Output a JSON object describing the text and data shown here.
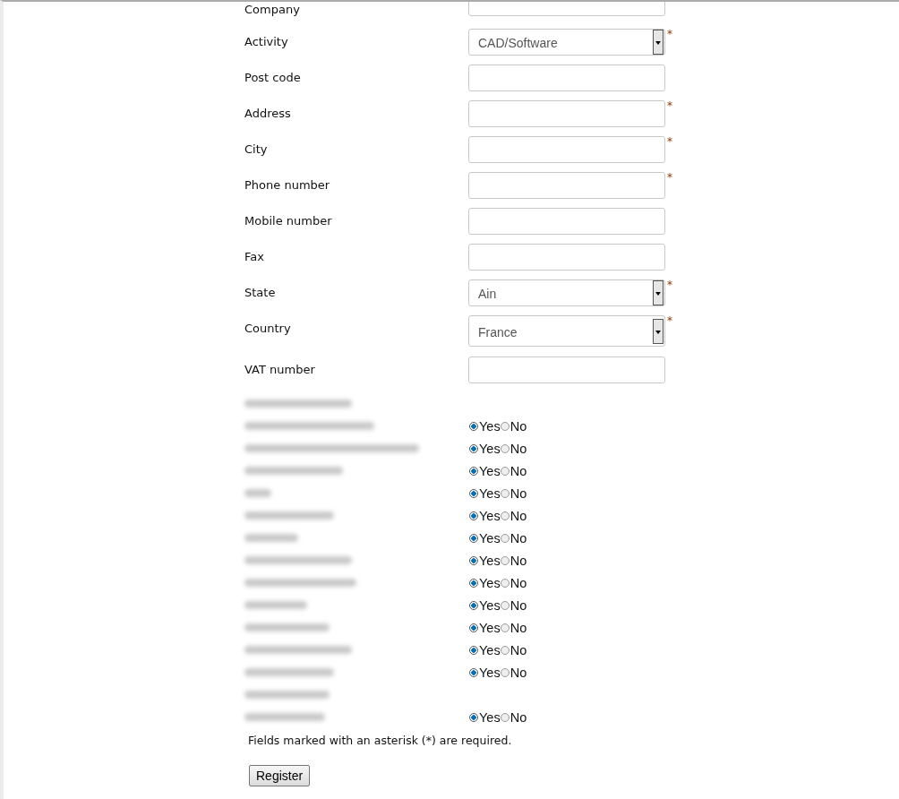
{
  "fields": [
    {
      "kind": "text",
      "label": "Company",
      "required": false
    },
    {
      "kind": "select",
      "label": "Activity",
      "value": "CAD/Software",
      "required": true
    },
    {
      "kind": "text",
      "label": "Post code",
      "required": false
    },
    {
      "kind": "text",
      "label": "Address",
      "required": true
    },
    {
      "kind": "text",
      "label": "City",
      "required": true
    },
    {
      "kind": "text",
      "label": "Phone number",
      "required": true
    },
    {
      "kind": "text",
      "label": "Mobile number",
      "required": false
    },
    {
      "kind": "text",
      "label": "Fax",
      "required": false
    },
    {
      "kind": "select",
      "label": "State",
      "value": "Ain",
      "required": true
    },
    {
      "kind": "select",
      "label": "Country",
      "value": "France",
      "required": true
    },
    {
      "kind": "text",
      "label": "VAT number",
      "required": false
    }
  ],
  "required_mark": "*",
  "interests": [
    {
      "kind": "heading"
    },
    {
      "kind": "choice",
      "options": [
        {
          "label": "Yes",
          "selected": true
        },
        {
          "label": "No",
          "selected": false
        }
      ]
    },
    {
      "kind": "choice",
      "options": [
        {
          "label": "Yes",
          "selected": true
        },
        {
          "label": "No",
          "selected": false
        }
      ]
    },
    {
      "kind": "choice",
      "options": [
        {
          "label": "Yes",
          "selected": true
        },
        {
          "label": "No",
          "selected": false
        }
      ]
    },
    {
      "kind": "choice",
      "options": [
        {
          "label": "Yes",
          "selected": true
        },
        {
          "label": "No",
          "selected": false
        }
      ]
    },
    {
      "kind": "choice",
      "options": [
        {
          "label": "Yes",
          "selected": true
        },
        {
          "label": "No",
          "selected": false
        }
      ]
    },
    {
      "kind": "choice",
      "options": [
        {
          "label": "Yes",
          "selected": true
        },
        {
          "label": "No",
          "selected": false
        }
      ]
    },
    {
      "kind": "choice",
      "options": [
        {
          "label": "Yes",
          "selected": true
        },
        {
          "label": "No",
          "selected": false
        }
      ]
    },
    {
      "kind": "choice",
      "options": [
        {
          "label": "Yes",
          "selected": true
        },
        {
          "label": "No",
          "selected": false
        }
      ]
    },
    {
      "kind": "choice",
      "options": [
        {
          "label": "Yes",
          "selected": true
        },
        {
          "label": "No",
          "selected": false
        }
      ]
    },
    {
      "kind": "choice",
      "options": [
        {
          "label": "Yes",
          "selected": true
        },
        {
          "label": "No",
          "selected": false
        }
      ]
    },
    {
      "kind": "choice",
      "options": [
        {
          "label": "Yes",
          "selected": true
        },
        {
          "label": "No",
          "selected": false
        }
      ]
    },
    {
      "kind": "choice",
      "options": [
        {
          "label": "Yes",
          "selected": true
        },
        {
          "label": "No",
          "selected": false
        }
      ]
    },
    {
      "kind": "heading"
    },
    {
      "kind": "choice",
      "options": [
        {
          "label": "Yes",
          "selected": true
        },
        {
          "label": "No",
          "selected": false
        }
      ]
    }
  ],
  "note": "Fields marked with an asterisk (*) are required.",
  "submit_button": "Register"
}
